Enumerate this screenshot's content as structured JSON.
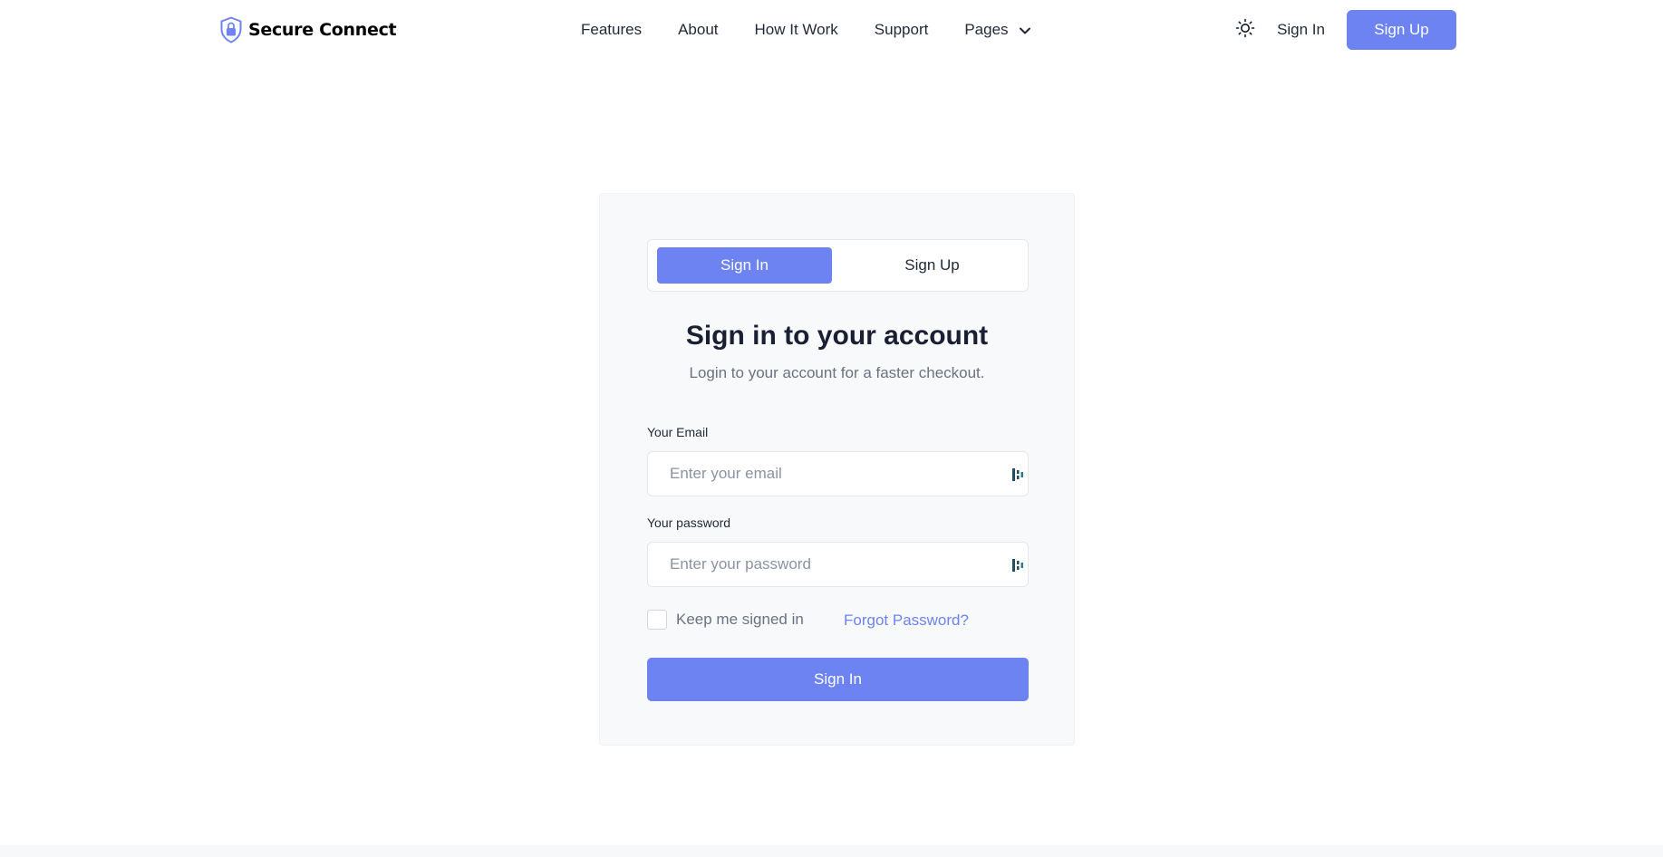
{
  "brand": {
    "name": "Secure Connect",
    "icon": "shield-lock-icon",
    "accent": "#6d83f2"
  },
  "nav": {
    "items": [
      "Features",
      "About",
      "How It Work",
      "Support"
    ],
    "pages_label": "Pages",
    "pages_icon": "chevron-down-icon"
  },
  "header": {
    "theme_icon": "sun-icon",
    "signin_label": "Sign In",
    "signup_label": "Sign Up"
  },
  "auth_card": {
    "tabs": [
      {
        "label": "Sign In",
        "active": true
      },
      {
        "label": "Sign Up",
        "active": false
      }
    ],
    "title": "Sign in to your account",
    "subtitle": "Login to your account for a faster checkout.",
    "email": {
      "label": "Your Email",
      "placeholder": "Enter your email",
      "value": ""
    },
    "password": {
      "label": "Your password",
      "placeholder": "Enter your password",
      "value": ""
    },
    "remember_label": "Keep me signed in",
    "remember_checked": false,
    "forgot_label": "Forgot Password?",
    "submit_label": "Sign In"
  }
}
